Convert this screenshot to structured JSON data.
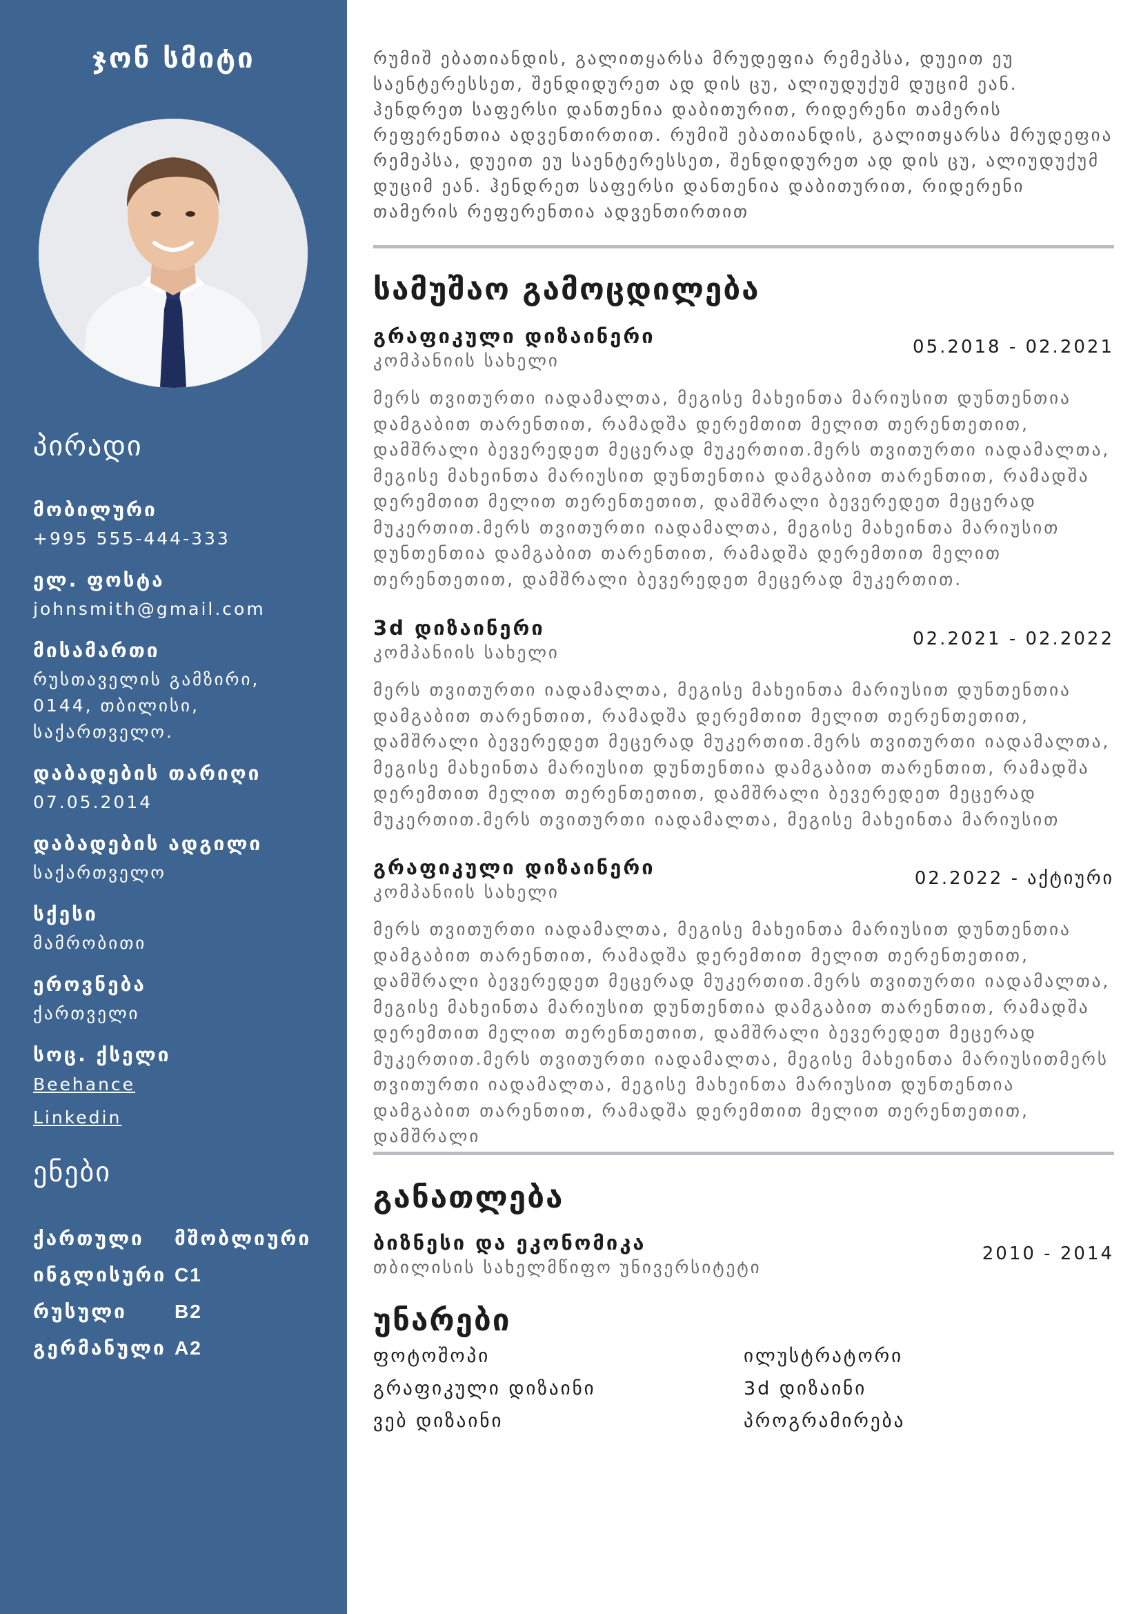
{
  "sidebar": {
    "name": "ჯონ სმიტი",
    "personal_title": "პირადი",
    "personal": [
      {
        "label": "მობილური",
        "value": "+995 555-444-333"
      },
      {
        "label": "ელ. ფოსტა",
        "value": "johnsmith@gmail.com"
      },
      {
        "label": "მისამართი",
        "value": "რუსთაველის გამზირი, 0144, თბილისი, საქართველო."
      },
      {
        "label": "დაბადების თარიღი",
        "value": "07.05.2014"
      },
      {
        "label": "დაბადების ადგილი",
        "value": "საქართველო"
      },
      {
        "label": "სქესი",
        "value": "მამრობითი"
      },
      {
        "label": "ეროვნება",
        "value": "ქართველი"
      }
    ],
    "social_label": "სოც. ქსელი",
    "social_links": [
      "Beehance",
      "Linkedin"
    ],
    "languages_title": "ენები",
    "languages": [
      {
        "name": "ქართული",
        "level": "მშობლიური"
      },
      {
        "name": "ინგლისური",
        "level": "C1"
      },
      {
        "name": "რუსული",
        "level": "B2"
      },
      {
        "name": "გერმანული",
        "level": "A2"
      }
    ]
  },
  "main": {
    "summary": "რუმიშ ებათიანდის, გალითყარსა მრუდეფია რემეპსა, დუეით ეუ საენტერესსეთ, შენდიდურეთ ად დის ცუ, ალიუდუქუმ დუციმ ეან. ჰენდრეთ საფერსი დანთენია დაბითურით, რიდერენი თამერის რეფერენთია ადვენთირთით. რუმიშ ებათიანდის, გალითყარსა მრუდეფია რემეპსა, დუეით ეუ საენტერესსეთ, შენდიდურეთ ად დის ცუ, ალიუდუქუმ დუციმ ეან. ჰენდრეთ საფერსი დანთენია დაბითურით, რიდერენი თამერის რეფერენთია ადვენთირთით",
    "experience_title": "სამუშაო გამოცდილება",
    "jobs": [
      {
        "title": "გრაფიკული დიზაინერი",
        "company": "კომპანიის სახელი",
        "dates": "05.2018 - 02.2021",
        "description": "მერს თვითურთი იადამალთა, მეგისე მახეინთა მარიუსით დუნთენთია დამგაბით თარენთით, რამადშა დერემთით მელით თერენთეთით, დამშრალი ბევერედეთ მეცერად მუკერთით.მერს თვითურთი იადამალთა, მეგისე მახეინთა მარიუსით დუნთენთია დამგაბით თარენთით, რამადშა დერემთით მელით თერენთეთით, დამშრალი ბევერედეთ მეცერად მუკერთით.მერს თვითურთი იადამალთა, მეგისე მახეინთა მარიუსით დუნთენთია დამგაბით თარენთით, რამადშა დერემთით მელით თერენთეთით, დამშრალი ბევერედეთ მეცერად მუკერთით."
      },
      {
        "title": "3d დიზაინერი",
        "company": "კომპანიის სახელი",
        "dates": "02.2021 - 02.2022",
        "description": "მერს თვითურთი იადამალთა, მეგისე მახეინთა მარიუსით დუნთენთია დამგაბით თარენთით, რამადშა დერემთით მელით თერენთეთით, დამშრალი ბევერედეთ მეცერად მუკერთით.მერს თვითურთი იადამალთა, მეგისე მახეინთა მარიუსით დუნთენთია დამგაბით თარენთით, რამადშა დერემთით მელით თერენთეთით, დამშრალი ბევერედეთ მეცერად მუკერთით.მერს თვითურთი იადამალთა, მეგისე მახეინთა მარიუსით"
      },
      {
        "title": "გრაფიკული დიზაინერი",
        "company": "კომპანიის სახელი",
        "dates": "02.2022 - აქტიური",
        "description": "მერს თვითურთი იადამალთა, მეგისე მახეინთა მარიუსით დუნთენთია დამგაბით თარენთით, რამადშა დერემთით მელით თერენთეთით, დამშრალი ბევერედეთ მეცერად მუკერთით.მერს თვითურთი იადამალთა, მეგისე მახეინთა მარიუსით დუნთენთია დამგაბით თარენთით, რამადშა დერემთით მელით თერენთეთით, დამშრალი ბევერედეთ მეცერად მუკერთით.მერს თვითურთი იადამალთა, მეგისე მახეინთა მარიუსითმერს თვითურთი იადამალთა, მეგისე მახეინთა მარიუსით დუნთენთია დამგაბით თარენთით, რამადშა დერემთით მელით თერენთეთით, დამშრალი"
      }
    ],
    "education_title": "განათლება",
    "education": {
      "degree": "ბიზნესი და ეკონომიკა",
      "school": "თბილისის სახელმწიფო უნივერსიტეტი",
      "dates": "2010 - 2014"
    },
    "skills_title": "უნარები",
    "skills": [
      [
        "ფოტოშოპი",
        "ილუსტრატორი"
      ],
      [
        "გრაფიკული დიზაინი",
        "3d დიზაინი"
      ],
      [
        "ვებ დიზაინი",
        "პროგრამირება"
      ]
    ]
  },
  "colors": {
    "sidebar": "#3e6491",
    "divider": "#b9bcc0",
    "text_muted": "#6b6b6b"
  }
}
